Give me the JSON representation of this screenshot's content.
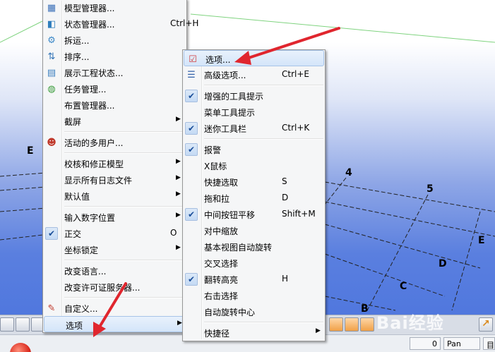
{
  "viewport": {
    "grid_labels": [
      "E",
      "4",
      "5",
      "E",
      "D",
      "C",
      "B"
    ]
  },
  "left_menu": {
    "items": [
      {
        "type": "item",
        "icon": "model-manager-icon",
        "label": "模型管理器...",
        "shortcut": "",
        "arrow": false,
        "checked": false
      },
      {
        "type": "item",
        "icon": "state-manager-icon",
        "label": "状态管理器...",
        "shortcut": "Ctrl+H",
        "arrow": false,
        "checked": false
      },
      {
        "type": "item",
        "icon": "disassemble-icon",
        "label": "拆运...",
        "shortcut": "",
        "arrow": false,
        "checked": false
      },
      {
        "type": "item",
        "icon": "sort-icon",
        "label": "排序...",
        "shortcut": "",
        "arrow": false,
        "checked": false
      },
      {
        "type": "item",
        "icon": "project-status-icon",
        "label": "展示工程状态...",
        "shortcut": "",
        "arrow": false,
        "checked": false
      },
      {
        "type": "item",
        "icon": "task-manager-icon",
        "label": "任务管理...",
        "shortcut": "",
        "arrow": false,
        "checked": false
      },
      {
        "type": "item",
        "icon": "",
        "label": "布置管理器...",
        "shortcut": "",
        "arrow": false,
        "checked": false
      },
      {
        "type": "item",
        "icon": "",
        "label": "截屏",
        "shortcut": "",
        "arrow": true,
        "checked": false
      },
      {
        "type": "sep"
      },
      {
        "type": "item",
        "icon": "multi-user-icon",
        "label": "活动的多用户...",
        "shortcut": "",
        "arrow": false,
        "checked": false
      },
      {
        "type": "sep"
      },
      {
        "type": "item",
        "icon": "",
        "label": "校核和修正模型",
        "shortcut": "",
        "arrow": true,
        "checked": false
      },
      {
        "type": "item",
        "icon": "",
        "label": "显示所有日志文件",
        "shortcut": "",
        "arrow": true,
        "checked": false
      },
      {
        "type": "item",
        "icon": "",
        "label": "默认值",
        "shortcut": "",
        "arrow": true,
        "checked": false
      },
      {
        "type": "sep"
      },
      {
        "type": "item",
        "icon": "",
        "label": "输入数字位置",
        "shortcut": "",
        "arrow": true,
        "checked": false
      },
      {
        "type": "item",
        "icon": "",
        "label": "正交",
        "shortcut": "O",
        "arrow": false,
        "checked": true
      },
      {
        "type": "item",
        "icon": "",
        "label": "坐标锁定",
        "shortcut": "",
        "arrow": true,
        "checked": false
      },
      {
        "type": "sep"
      },
      {
        "type": "item",
        "icon": "",
        "label": "改变语言...",
        "shortcut": "",
        "arrow": false,
        "checked": false
      },
      {
        "type": "item",
        "icon": "",
        "label": "改变许可证服务器...",
        "shortcut": "",
        "arrow": false,
        "checked": false
      },
      {
        "type": "sep"
      },
      {
        "type": "item",
        "icon": "customize-icon",
        "label": "自定义...",
        "shortcut": "",
        "arrow": false,
        "checked": false
      },
      {
        "type": "item",
        "icon": "",
        "label": "选项",
        "shortcut": "",
        "arrow": true,
        "checked": false,
        "highlighted": true
      }
    ]
  },
  "right_menu": {
    "items": [
      {
        "type": "item",
        "icon": "options-check-icon",
        "label": "选项...",
        "shortcut": "",
        "arrow": false,
        "checked": false,
        "highlighted": true
      },
      {
        "type": "item",
        "icon": "advanced-options-icon",
        "label": "高级选项...",
        "shortcut": "Ctrl+E",
        "arrow": false,
        "checked": false
      },
      {
        "type": "sep"
      },
      {
        "type": "item",
        "icon": "",
        "label": "增强的工具提示",
        "shortcut": "",
        "arrow": false,
        "checked": true
      },
      {
        "type": "item",
        "icon": "",
        "label": "菜单工具提示",
        "shortcut": "",
        "arrow": false,
        "checked": false
      },
      {
        "type": "item",
        "icon": "",
        "label": "迷你工具栏",
        "shortcut": "Ctrl+K",
        "arrow": false,
        "checked": true
      },
      {
        "type": "sep"
      },
      {
        "type": "item",
        "icon": "",
        "label": "报警",
        "shortcut": "",
        "arrow": false,
        "checked": true
      },
      {
        "type": "item",
        "icon": "",
        "label": "X鼠标",
        "shortcut": "",
        "arrow": false,
        "checked": false
      },
      {
        "type": "item",
        "icon": "",
        "label": "快捷选取",
        "shortcut": "S",
        "arrow": false,
        "checked": false
      },
      {
        "type": "item",
        "icon": "",
        "label": "拖和拉",
        "shortcut": "D",
        "arrow": false,
        "checked": false
      },
      {
        "type": "item",
        "icon": "",
        "label": "中间按钮平移",
        "shortcut": "Shift+M",
        "arrow": false,
        "checked": true
      },
      {
        "type": "item",
        "icon": "",
        "label": "对中缩放",
        "shortcut": "",
        "arrow": false,
        "checked": false
      },
      {
        "type": "item",
        "icon": "",
        "label": "基本视图自动旋转",
        "shortcut": "",
        "arrow": false,
        "checked": false
      },
      {
        "type": "item",
        "icon": "",
        "label": "交叉选择",
        "shortcut": "",
        "arrow": false,
        "checked": false
      },
      {
        "type": "item",
        "icon": "",
        "label": "翻转高亮",
        "shortcut": "H",
        "arrow": false,
        "checked": true
      },
      {
        "type": "item",
        "icon": "",
        "label": "右击选择",
        "shortcut": "",
        "arrow": false,
        "checked": false
      },
      {
        "type": "item",
        "icon": "",
        "label": "自动旋转中心",
        "shortcut": "",
        "arrow": false,
        "checked": false
      },
      {
        "type": "sep"
      },
      {
        "type": "item",
        "icon": "",
        "label": "快捷径",
        "shortcut": "",
        "arrow": true,
        "checked": false
      }
    ]
  },
  "status_bar": {
    "value": "0",
    "mode": "Pan",
    "extra": "目"
  },
  "watermark": "Bai经验",
  "colors": {
    "accent_red": "#e0262e",
    "check_blue": "#1b4f9a",
    "viewport_blue": "#4a73de"
  }
}
